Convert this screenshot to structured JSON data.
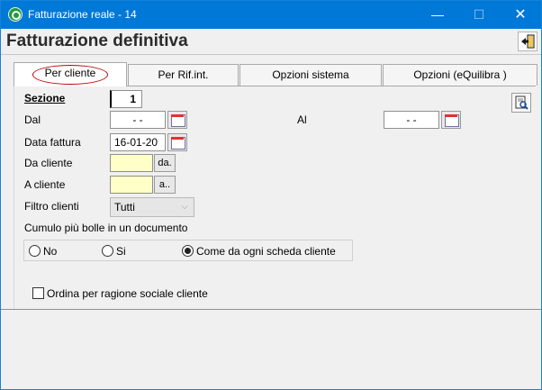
{
  "window": {
    "title": "Fatturazione reale - 14",
    "minimize_glyph": "—",
    "maximize_glyph": "☐",
    "close_glyph": "✕"
  },
  "header": {
    "title": "Fatturazione definitiva"
  },
  "tabs": [
    {
      "label": "Per cliente",
      "active": true
    },
    {
      "label": "Per Rif.int.",
      "active": false
    },
    {
      "label": "Opzioni sistema",
      "active": false
    },
    {
      "label": "Opzioni (eQuilibra )",
      "active": false
    }
  ],
  "form": {
    "sezione_label": "Sezione",
    "sezione_value": "1",
    "dal_label": "Dal",
    "dal_value": "- -",
    "al_label": "Al",
    "al_value": "- -",
    "data_fattura_label": "Data fattura",
    "data_fattura_value": "16-01-20",
    "da_cliente_label": "Da cliente",
    "da_cliente_value": "",
    "da_button": "da.",
    "a_cliente_label": "A cliente",
    "a_cliente_value": "",
    "a_button": "a..",
    "filtro_clienti_label": "Filtro clienti",
    "filtro_clienti_value": "Tutti",
    "cumulo_label": "Cumulo più bolle in un documento",
    "cumulo_options": [
      "No",
      "Si",
      "Come da ogni scheda cliente"
    ],
    "cumulo_selected": "Come da ogni scheda cliente",
    "ordina_label": "Ordina per ragione sociale cliente",
    "ordina_checked": false
  },
  "icons": {
    "app": "qlik-app-icon",
    "exit": "exit-door-icon",
    "calendar": "calendar-icon",
    "print_preview": "print-preview-icon"
  },
  "colors": {
    "titlebar": "#0078d7",
    "highlight_oval": "#c00000",
    "client_field": "#ffffc8"
  }
}
